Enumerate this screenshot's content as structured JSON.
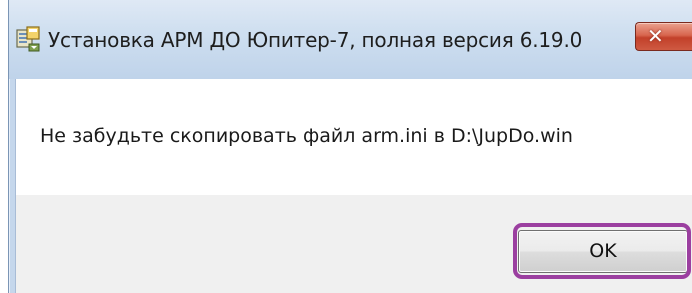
{
  "window": {
    "title": "Установка АРМ ДО Юпитер-7, полная версия 6.19.0",
    "close_label": "✕"
  },
  "message": {
    "text": "Не забудьте скопировать файл arm.ini в D:\\JupDo.win"
  },
  "buttons": {
    "ok_label": "OK"
  },
  "icons": {
    "title_icon": "installer-icon",
    "close_icon": "close-icon"
  },
  "colors": {
    "highlight": "#9b3fa0",
    "close_button": "#c94a33",
    "titlebar": "#cfdff0"
  }
}
